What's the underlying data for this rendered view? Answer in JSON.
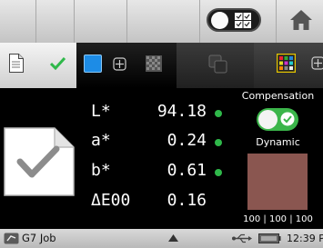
{
  "colors": {
    "accent_green": "#2fb84a",
    "toggle_green": "#3bb54a",
    "selected_patch_blue": "#1d8ce6",
    "swatch": "#8a5650"
  },
  "toolbar": {
    "mode_toggle_icons": [
      "toggle-knob",
      "grid-check-icon"
    ],
    "home_icon": "home-icon"
  },
  "tabs": [
    {
      "name": "document-check",
      "icons": [
        "document-icon",
        "checkmark-icon"
      ],
      "selected": false
    },
    {
      "name": "measure",
      "icons": [
        "blue-square-icon",
        "crosshair-icon",
        "patch-grid-icon"
      ],
      "selected": true
    },
    {
      "name": "compare",
      "icons": [
        "overlap-squares-icon"
      ],
      "selected": false
    },
    {
      "name": "patch-target",
      "icons": [
        "colored-patch-icon",
        "crosshair-icon"
      ],
      "selected": false
    }
  ],
  "measurements": [
    {
      "label": "L*",
      "value": "94.18",
      "status": "ok"
    },
    {
      "label": "a*",
      "value": "0.24",
      "status": "ok"
    },
    {
      "label": "b*",
      "value": "0.61",
      "status": "ok"
    },
    {
      "label": "ΔE00",
      "value": "0.16",
      "status": "none"
    }
  ],
  "side_panel": {
    "compensation_label": "Compensation",
    "compensation_on": true,
    "dynamic_label": "Dynamic",
    "swatch_rgb": "100 | 100 | 100"
  },
  "statusbar": {
    "job_label": "G7 Job",
    "time": "12:39 P"
  }
}
